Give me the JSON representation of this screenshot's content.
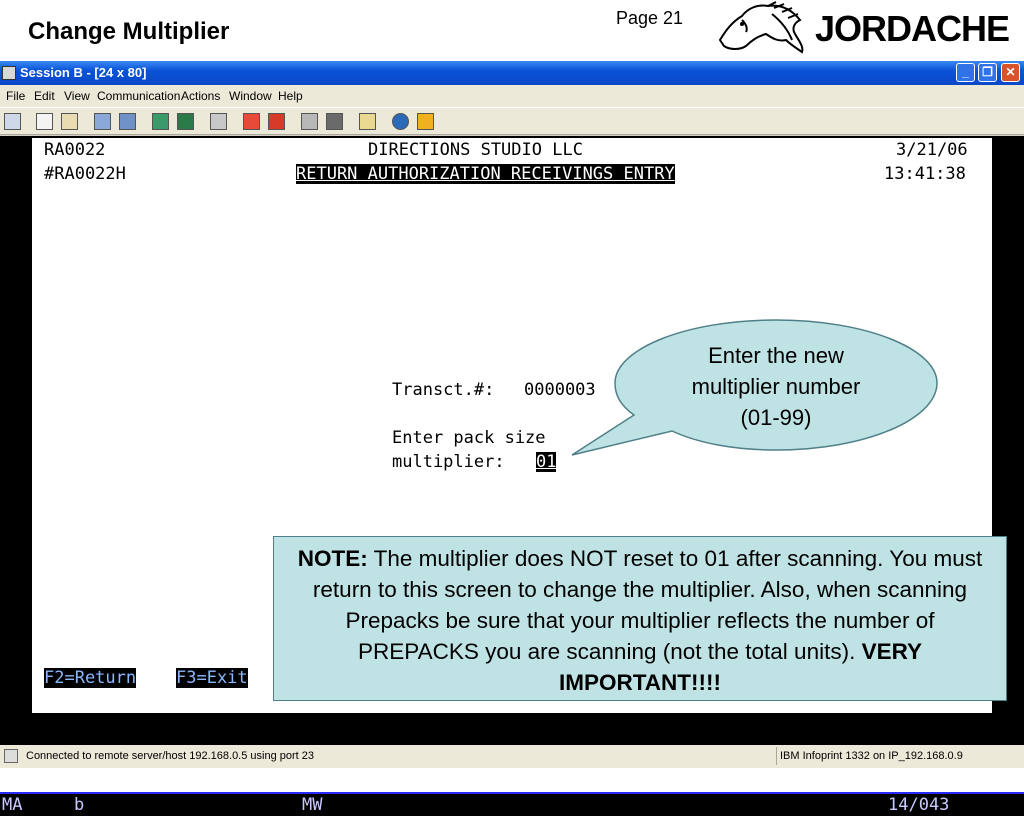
{
  "slide": {
    "title": "Change Multiplier",
    "page": "Page 21",
    "logo_text": "JORDACHE"
  },
  "window": {
    "title": "Session B - [24 x 80]",
    "controls": {
      "minimize": "_",
      "maximize": "❐",
      "close": "✕"
    }
  },
  "menu": [
    "File",
    "Edit",
    "View",
    "Communication",
    "Actions",
    "Window",
    "Help"
  ],
  "toolbar_icons": [
    "screen-icon",
    "copy-icon",
    "paste-icon",
    "send-icon",
    "receive-icon",
    "macro-icon",
    "keypad-icon",
    "print-icon",
    "record-icon",
    "stop-icon",
    "play-icon",
    "transfer-icon",
    "clipboard-icon",
    "globe-icon",
    "edit-icon"
  ],
  "terminal": {
    "program_id": "RA0022",
    "company": "DIRECTIONS STUDIO LLC",
    "date": "3/21/06",
    "screen_id": "#RA0022H",
    "screen_title": "RETURN AUTHORIZATION RECEIVINGS ENTRY",
    "time": "13:41:38",
    "transct_label": "Transct.#:",
    "transct_value": "0000003",
    "pack_label_1": "Enter pack size",
    "pack_label_2": "multiplier:",
    "multiplier_value": "01",
    "f2": "F2=Return",
    "f3": "F3=Exit"
  },
  "statusline": {
    "mode": "MA",
    "indicator": "b",
    "mw": "MW",
    "position": "14/043"
  },
  "connection": {
    "status": "Connected to remote server/host 192.168.0.5 using port 23",
    "printer": "IBM Infoprint 1332 on IP_192.168.0.9"
  },
  "callout": {
    "line1": "Enter the new",
    "line2": "multiplier number",
    "line3": "(01-99)"
  },
  "note": {
    "label": "NOTE:",
    "text": " The multiplier does NOT reset to 01 after scanning. You must return to this screen to change the multiplier. Also, when scanning Prepacks be sure that your multiplier reflects the number of PREPACKS you are scanning (not the total units). ",
    "emphasis": "VERY IMPORTANT!!!!"
  }
}
